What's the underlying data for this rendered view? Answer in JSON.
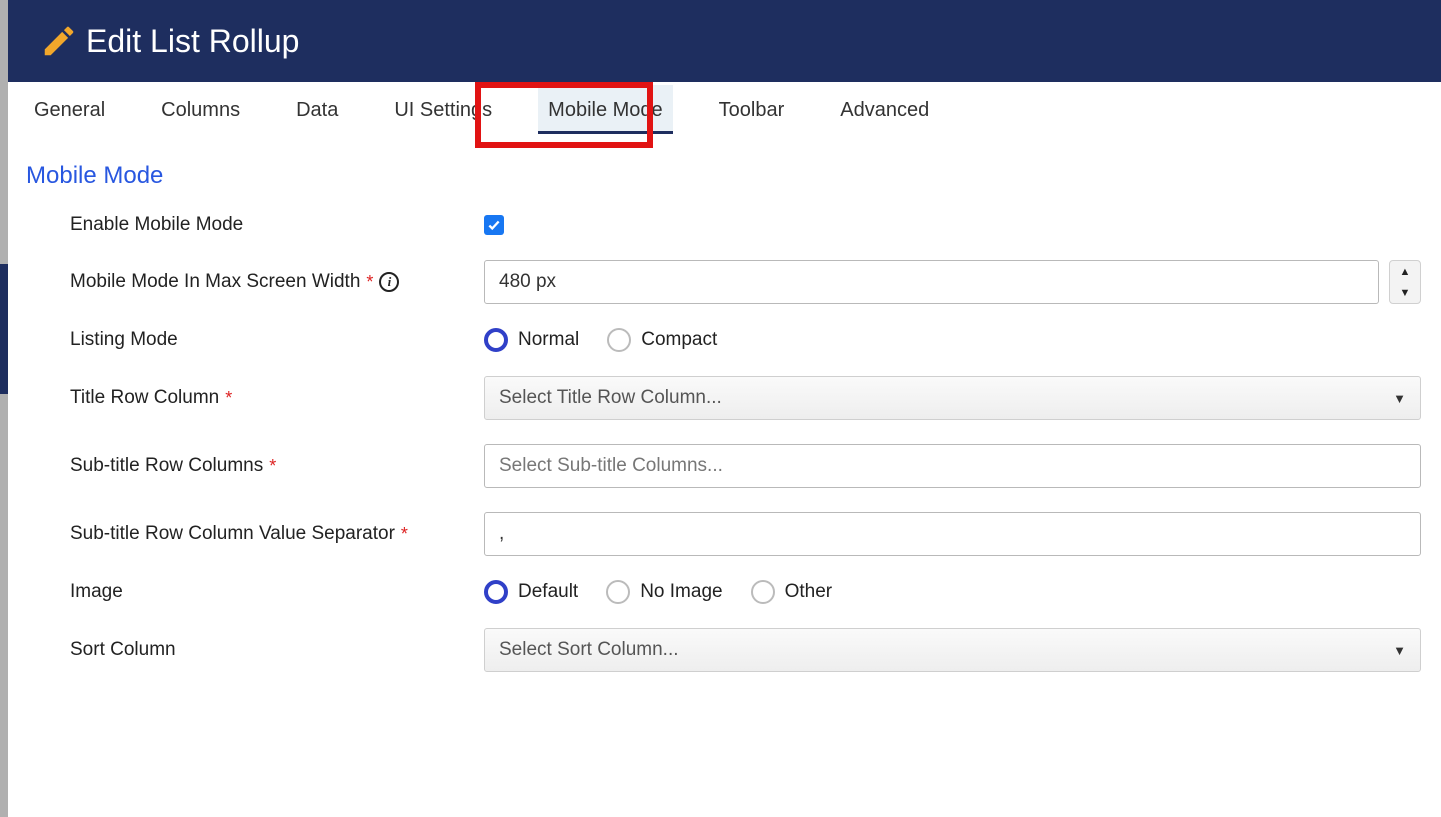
{
  "header": {
    "title": "Edit List Rollup"
  },
  "tabs": [
    {
      "label": "General"
    },
    {
      "label": "Columns"
    },
    {
      "label": "Data"
    },
    {
      "label": "UI Settings"
    },
    {
      "label": "Mobile Mode",
      "active": true
    },
    {
      "label": "Toolbar"
    },
    {
      "label": "Advanced"
    }
  ],
  "section_title": "Mobile Mode",
  "fields": {
    "enable": {
      "label": "Enable Mobile Mode",
      "checked": true
    },
    "max_width": {
      "label": "Mobile Mode In Max Screen Width",
      "value": "480 px"
    },
    "listing_mode": {
      "label": "Listing Mode",
      "options": {
        "normal": "Normal",
        "compact": "Compact"
      },
      "selected": "normal"
    },
    "title_row": {
      "label": "Title Row Column",
      "placeholder": "Select Title Row Column..."
    },
    "subtitle_cols": {
      "label": "Sub-title Row Columns",
      "placeholder": "Select Sub-title Columns..."
    },
    "separator": {
      "label": "Sub-title Row Column Value Separator",
      "value": ","
    },
    "image": {
      "label": "Image",
      "options": {
        "default": "Default",
        "none": "No Image",
        "other": "Other"
      },
      "selected": "default"
    },
    "sort_col": {
      "label": "Sort Column",
      "placeholder": "Select Sort Column..."
    }
  }
}
